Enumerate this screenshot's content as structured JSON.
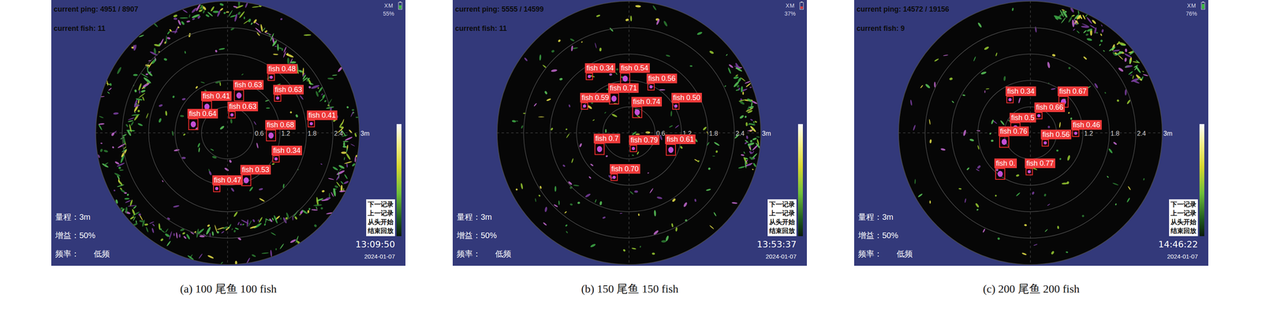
{
  "figure": {
    "panels": [
      {
        "caption": "(a) 100 尾鱼 100 fish",
        "current_ping": "current ping: 4951 / 8907",
        "current_fish": "current fish: 11",
        "logo": "XM",
        "battery": {
          "reading": "55%",
          "level": 0.55
        },
        "ring_labels": [
          "0.6",
          "1.2",
          "1.8",
          "2.4",
          "3m"
        ],
        "range": "量程：3m",
        "gain": "增益：50%",
        "frequency_label": "频率：",
        "frequency": "低频",
        "buttons": [
          "下一记录",
          "上一记录",
          "从头开始",
          "结束回放"
        ],
        "time": "13:09:50",
        "date": "2024-01-07",
        "detections": [
          {
            "label": "fish 0.48"
          },
          {
            "label": "fish 0.63"
          },
          {
            "label": "fish 0.63"
          },
          {
            "label": "fish 0.41"
          },
          {
            "label": "fish 0.63"
          },
          {
            "label": "fish 0.64"
          },
          {
            "label": "fish 0.41"
          },
          {
            "label": "fish 0.68"
          },
          {
            "label": "fish 0.34"
          },
          {
            "label": "fish 0.53"
          },
          {
            "label": "fish 0.47"
          }
        ]
      },
      {
        "caption": "(b) 150 尾鱼 150 fish",
        "current_ping": "current ping: 5555 / 14599",
        "current_fish": "current fish: 11",
        "logo": "XM",
        "battery": {
          "reading": "37%",
          "level": 0.37
        },
        "ring_labels": [
          "0.6",
          "1.2",
          "1.8",
          "2.4",
          "3m"
        ],
        "range": "量程：3m",
        "gain": "增益：50%",
        "frequency_label": "频率：",
        "frequency": "低频",
        "buttons": [
          "下一记录",
          "上一记录",
          "从头开始",
          "结束回放"
        ],
        "time": "13:53:37",
        "date": "2024-01-07",
        "detections": [
          {
            "label": "fish 0.34"
          },
          {
            "label": "fish 0.54"
          },
          {
            "label": "fish 0.56"
          },
          {
            "label": "fish 0.71"
          },
          {
            "label": "fish 0.59"
          },
          {
            "label": "fish 0.74"
          },
          {
            "label": "fish 0.50"
          },
          {
            "label": "fish 0.7"
          },
          {
            "label": "fish 0.79"
          },
          {
            "label": "fish 0.61"
          },
          {
            "label": "fish 0.70"
          }
        ]
      },
      {
        "caption": "(c) 200 尾鱼 200 fish",
        "current_ping": "current ping: 14572 / 19156",
        "current_fish": "current fish: 9",
        "logo": "XM",
        "battery": {
          "reading": "76%",
          "level": 0.76
        },
        "ring_labels": [
          "0.6",
          "1.2",
          "1.8",
          "2.4",
          "3m"
        ],
        "range": "量程：3m",
        "gain": "增益：50%",
        "frequency_label": "频率：",
        "frequency": "低频",
        "buttons": [
          "下一记录",
          "上一记录",
          "从头开始",
          "结束回放"
        ],
        "time": "14:46:22",
        "date": "2024-01-07",
        "detections": [
          {
            "label": "fish 0.34"
          },
          {
            "label": "fish 0.67"
          },
          {
            "label": "fish 0.66"
          },
          {
            "label": "fish 0.5"
          },
          {
            "label": "fish 0.46"
          },
          {
            "label": "fish 0.76"
          },
          {
            "label": "fish 0.56"
          },
          {
            "label": "fish 0."
          },
          {
            "label": "fish 0.77"
          }
        ]
      }
    ]
  }
}
